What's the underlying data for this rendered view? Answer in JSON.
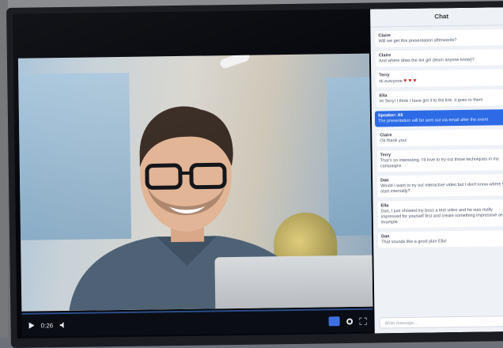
{
  "chat": {
    "title": "Chat",
    "messages": [
      {
        "name": "Claire",
        "text": "Will we get this presentation afterwards?"
      },
      {
        "name": "Claire",
        "text": "And where does the lint girl (team anyone know)?"
      },
      {
        "name": "Terry",
        "text": "Hi everyone",
        "hearts": "♥ ♥ ♥"
      },
      {
        "name": "Ella",
        "text": "Hi Terry! I think I have got it to the link. it goes to them"
      },
      {
        "name": "Speaker: Ali",
        "text": "The presentation will be sent out via email after the event"
      },
      {
        "name": "Claire",
        "text": "Ok thank you!"
      },
      {
        "name": "Terry",
        "text": "That's so interesting. I'd love to try out those techniques in my campaigns"
      },
      {
        "name": "Dan",
        "text": "Would I want to try out interactive video but I don't know where to start internally?"
      },
      {
        "name": "Ella",
        "text": "Dan, I just showed my boss a test video and he was really impressed for yourself first and create something impressive as an example"
      },
      {
        "name": "Dan",
        "text": "That sounds like a good plan Ella!"
      }
    ],
    "input_placeholder": "Write message..."
  },
  "player": {
    "time": "0:26",
    "icons": {
      "play": "play-icon",
      "volume": "volume-icon",
      "chat_toggle": "chat-toggle-icon",
      "settings": "gear-icon",
      "fullscreen": "fullscreen-icon"
    }
  },
  "colors": {
    "accent": "#2d6be6",
    "hearts": "#d92d2d",
    "chat_bg": "#eef1f6"
  }
}
